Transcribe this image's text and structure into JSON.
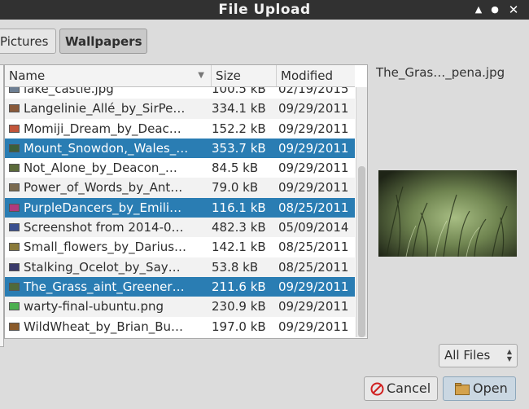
{
  "window": {
    "title": "File Upload",
    "controls": [
      "up-arrow-icon",
      "maximize-icon",
      "close-icon"
    ]
  },
  "breadcrumbs": [
    {
      "label": "Pictures",
      "active": false
    },
    {
      "label": "Wallpapers",
      "active": true
    }
  ],
  "file_list": {
    "columns": {
      "name": "Name",
      "size": "Size",
      "modified": "Modified"
    },
    "rows": [
      {
        "name": "lake_castle.jpg",
        "size": "100.5 kB",
        "modified": "02/19/2015",
        "selected": false,
        "icon_color": "#6d7f93"
      },
      {
        "name": "Langelinie_Allé_by_SirPe…",
        "size": "334.1 kB",
        "modified": "09/29/2011",
        "selected": false,
        "icon_color": "#8a5a3a"
      },
      {
        "name": "Momiji_Dream_by_Deac…",
        "size": "152.2 kB",
        "modified": "09/29/2011",
        "selected": false,
        "icon_color": "#c2553a"
      },
      {
        "name": "Mount_Snowdon,_Wales_…",
        "size": "353.7 kB",
        "modified": "09/29/2011",
        "selected": true,
        "icon_color": "#3c5f3a"
      },
      {
        "name": "Not_Alone_by_Deacon_…",
        "size": "84.5 kB",
        "modified": "09/29/2011",
        "selected": false,
        "icon_color": "#5b6a3a"
      },
      {
        "name": "Power_of_Words_by_Ant…",
        "size": "79.0 kB",
        "modified": "09/29/2011",
        "selected": false,
        "icon_color": "#7a6a4f"
      },
      {
        "name": "PurpleDancers_by_Emili…",
        "size": "116.1 kB",
        "modified": "08/25/2011",
        "selected": true,
        "icon_color": "#b03a7d"
      },
      {
        "name": "Screenshot from 2014-0…",
        "size": "482.3 kB",
        "modified": "05/09/2014",
        "selected": false,
        "icon_color": "#3a4f8f"
      },
      {
        "name": "Small_flowers_by_Darius…",
        "size": "142.1 kB",
        "modified": "08/25/2011",
        "selected": false,
        "icon_color": "#8a7a3a"
      },
      {
        "name": "Stalking_Ocelot_by_Say…",
        "size": "53.8 kB",
        "modified": "08/25/2011",
        "selected": false,
        "icon_color": "#3a3a6a"
      },
      {
        "name": "The_Grass_aint_Greener…",
        "size": "211.6 kB",
        "modified": "09/29/2011",
        "selected": true,
        "icon_color": "#4f6a3a"
      },
      {
        "name": "warty-final-ubuntu.png",
        "size": "230.9 kB",
        "modified": "09/29/2011",
        "selected": false,
        "icon_color": "#4caf50"
      },
      {
        "name": "WildWheat_by_Brian_Bu…",
        "size": "197.0 kB",
        "modified": "09/29/2011",
        "selected": false,
        "icon_color": "#8a5a2a"
      }
    ]
  },
  "preview": {
    "filename": "The_Gras…_pena.jpg"
  },
  "filter": {
    "selected": "All Files"
  },
  "buttons": {
    "cancel": "Cancel",
    "open": "Open"
  }
}
